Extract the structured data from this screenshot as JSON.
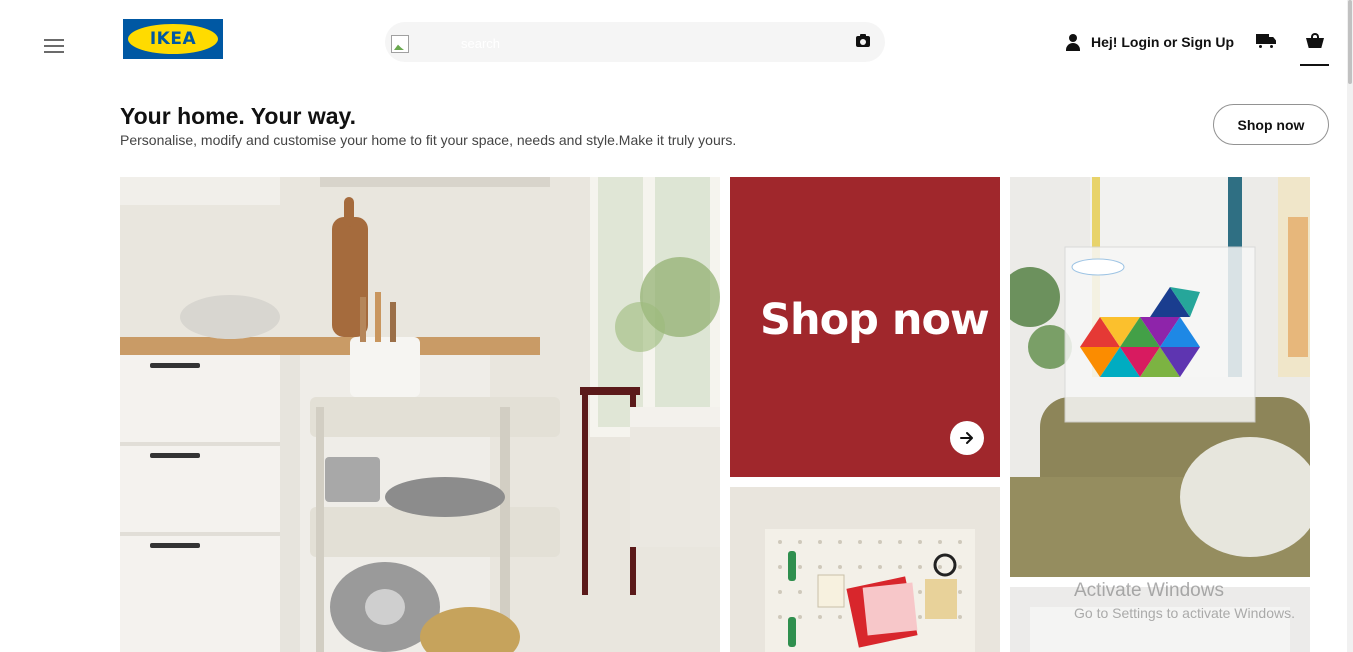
{
  "header": {
    "logo_text": "IKEA",
    "search_placeholder": "search",
    "login_label": "Hej! Login or Sign Up"
  },
  "hero": {
    "title": "Your home. Your way.",
    "subtitle": "Personalise, modify and customise your home to fit your space, needs and style.Make it truly yours.",
    "cta_label": "Shop now"
  },
  "promo_tile": {
    "label": "Shop now",
    "color": "#a0272c"
  },
  "watermark": {
    "title": "Activate Windows",
    "subtitle": "Go to Settings to activate Windows."
  },
  "colors": {
    "brand_blue": "#0058a3",
    "brand_yellow": "#ffdb00"
  },
  "icons": [
    "menu-icon",
    "image-icon",
    "camera-icon",
    "user-icon",
    "truck-icon",
    "basket-icon",
    "arrow-right-icon"
  ]
}
